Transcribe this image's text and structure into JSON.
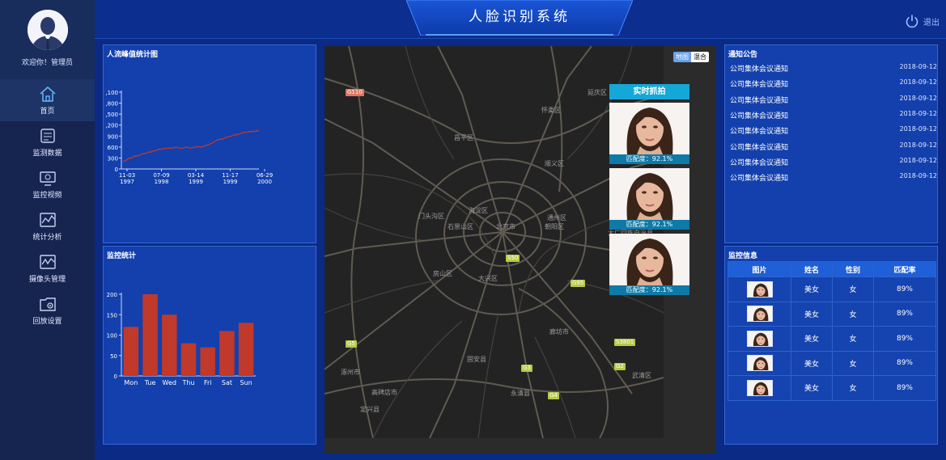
{
  "app": {
    "title": "人脸识别系统",
    "logout_label": "退出"
  },
  "user": {
    "welcome": "欢迎你！管理员"
  },
  "sidebar": {
    "items": [
      {
        "label": "首页",
        "icon": "home-icon"
      },
      {
        "label": "监测数据",
        "icon": "monitor-data-icon"
      },
      {
        "label": "监控视频",
        "icon": "video-monitor-icon"
      },
      {
        "label": "统计分析",
        "icon": "chart-analysis-icon"
      },
      {
        "label": "摄像头管理",
        "icon": "camera-manage-icon"
      },
      {
        "label": "回放设置",
        "icon": "playback-settings-icon"
      }
    ],
    "active_index": 0
  },
  "panels": {
    "peak_title": "人流峰值统计图",
    "monitor_stats_title": "监控统计",
    "notice_title": "通知公告",
    "monitor_info_title": "监控信息"
  },
  "map": {
    "toggle": [
      "地图",
      "混合"
    ],
    "snapshot_title": "实时抓拍",
    "snapshots": [
      {
        "caption": "匹配度：92.1%"
      },
      {
        "caption": "匹配度：92.1%"
      },
      {
        "caption": "匹配度：92.1%"
      }
    ],
    "labels": [
      "怀柔区",
      "延庆区",
      "顺义区",
      "昌平区",
      "门头沟区",
      "海淀区",
      "石景山区",
      "北京市",
      "朝阳区",
      "通州区",
      "房山区",
      "大兴区",
      "廊坊市",
      "固安县",
      "涿州市",
      "高碑店市",
      "永清县",
      "武清区",
      "定兴县",
      "大厂回族自治县"
    ],
    "road_badges": [
      "G110",
      "S50",
      "G95",
      "S3801",
      "G5",
      "G3",
      "G2",
      "G4"
    ]
  },
  "notices": [
    {
      "title": "公司集体会议通知",
      "date": "2018-09-12"
    },
    {
      "title": "公司集体会议通知",
      "date": "2018-09-12"
    },
    {
      "title": "公司集体会议通知",
      "date": "2018-09-12"
    },
    {
      "title": "公司集体会议通知",
      "date": "2018-09-12"
    },
    {
      "title": "公司集体会议通知",
      "date": "2018-09-12"
    },
    {
      "title": "公司集体会议通知",
      "date": "2018-09-12"
    },
    {
      "title": "公司集体会议通知",
      "date": "2018-09-12"
    },
    {
      "title": "公司集体会议通知",
      "date": "2018-09-12"
    }
  ],
  "monitor_table": {
    "headers": [
      "图片",
      "姓名",
      "性别",
      "匹配率"
    ],
    "rows": [
      {
        "name": "美女",
        "gender": "女",
        "rate": "89%"
      },
      {
        "name": "美女",
        "gender": "女",
        "rate": "89%"
      },
      {
        "name": "美女",
        "gender": "女",
        "rate": "89%"
      },
      {
        "name": "美女",
        "gender": "女",
        "rate": "89%"
      },
      {
        "name": "美女",
        "gender": "女",
        "rate": "89%"
      }
    ]
  },
  "chart_data": [
    {
      "type": "line",
      "title": "人流峰值统计图",
      "x_ticks": [
        "11-03\n1997",
        "07-09\n1998",
        "03-14\n1999",
        "11-17\n1999",
        "06-29\n2000"
      ],
      "y_ticks": [
        "0",
        "300",
        "600",
        "900",
        ",200",
        ",500",
        ",800",
        ",100"
      ],
      "ylim": [
        0,
        2100
      ],
      "series": [
        {
          "values": [
            205,
            215,
            240,
            275,
            300,
            290,
            320,
            345,
            360,
            355,
            370,
            395,
            410,
            430,
            420,
            445,
            470,
            455,
            480,
            500,
            495,
            520,
            540,
            530,
            545,
            560,
            550,
            565,
            575,
            560,
            580,
            570,
            590,
            600,
            585,
            575,
            560,
            570,
            580,
            600,
            590,
            575,
            570,
            585,
            590,
            600,
            615,
            605,
            590,
            610,
            625,
            640,
            650,
            665,
            690,
            710,
            735,
            760,
            790,
            800,
            815,
            810,
            830,
            850,
            870,
            880,
            890,
            900,
            920,
            935,
            930,
            950,
            960,
            975,
            990,
            1000,
            1010,
            1005,
            1020,
            1025,
            1010,
            1035,
            1030,
            1045,
            1040
          ]
        }
      ],
      "color": "#c0392b",
      "grid": false
    },
    {
      "type": "bar",
      "title": "监控统计",
      "categories": [
        "Mon",
        "Tue",
        "Wed",
        "Thu",
        "Fri",
        "Sat",
        "Sun"
      ],
      "values": [
        120,
        200,
        150,
        80,
        70,
        110,
        130
      ],
      "y_ticks": [
        0,
        50,
        100,
        150,
        200
      ],
      "ylim": [
        0,
        200
      ],
      "color": "#c0392b",
      "grid": false
    }
  ],
  "colors": {
    "accent": "#14a8d8",
    "panel": "#1340ad",
    "bar": "#c0392b",
    "line": "#c0392b"
  }
}
